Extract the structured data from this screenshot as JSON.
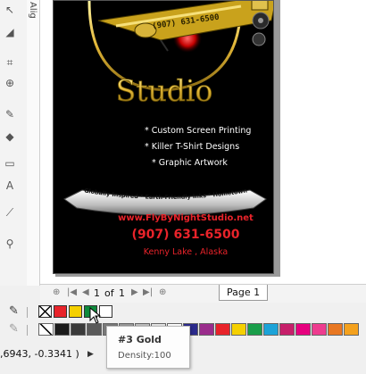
{
  "docker": {
    "align_label": "Alig"
  },
  "poster": {
    "phone_top": "(907) 631-6500",
    "studio": "Studio",
    "services": [
      "* Custom Screen Printing",
      "* Killer T-Shirt Designs",
      "* Graphic Artwork"
    ],
    "banner": "Globally Inspired * Earth-Friendly Inks * Hometown Craftsmanship",
    "website": "www.FlyByNightStudio.net",
    "phone": "(907) 631-6500",
    "location": "Kenny Lake , Alaska"
  },
  "page_nav": {
    "current": "1",
    "of_label": "of",
    "total": "1",
    "tab_label": "Page 1"
  },
  "document_palette": [
    "#ffffff",
    "#e8232a",
    "#f5d000",
    "#0f8a3c",
    "#ffffff"
  ],
  "color_palette": [
    "#ffffff",
    "#1b1b1b",
    "#3a3a3a",
    "#5a5a5a",
    "#7a7a7a",
    "#9a9a9a",
    "#bfbfbf",
    "#e6e6e6",
    "#ffffff",
    "#2b2a8c",
    "#9a2c8c",
    "#e8232a",
    "#f5d000",
    "#1a9e4a",
    "#1ca3d8",
    "#c61f6a",
    "#e6007e",
    "#ee3c8f",
    "#e87722",
    "#f4a11d"
  ],
  "tooltip": {
    "title": "#3 Gold",
    "density": "Density:100"
  },
  "status": {
    "coords": ",6943, -0.3341 )"
  }
}
